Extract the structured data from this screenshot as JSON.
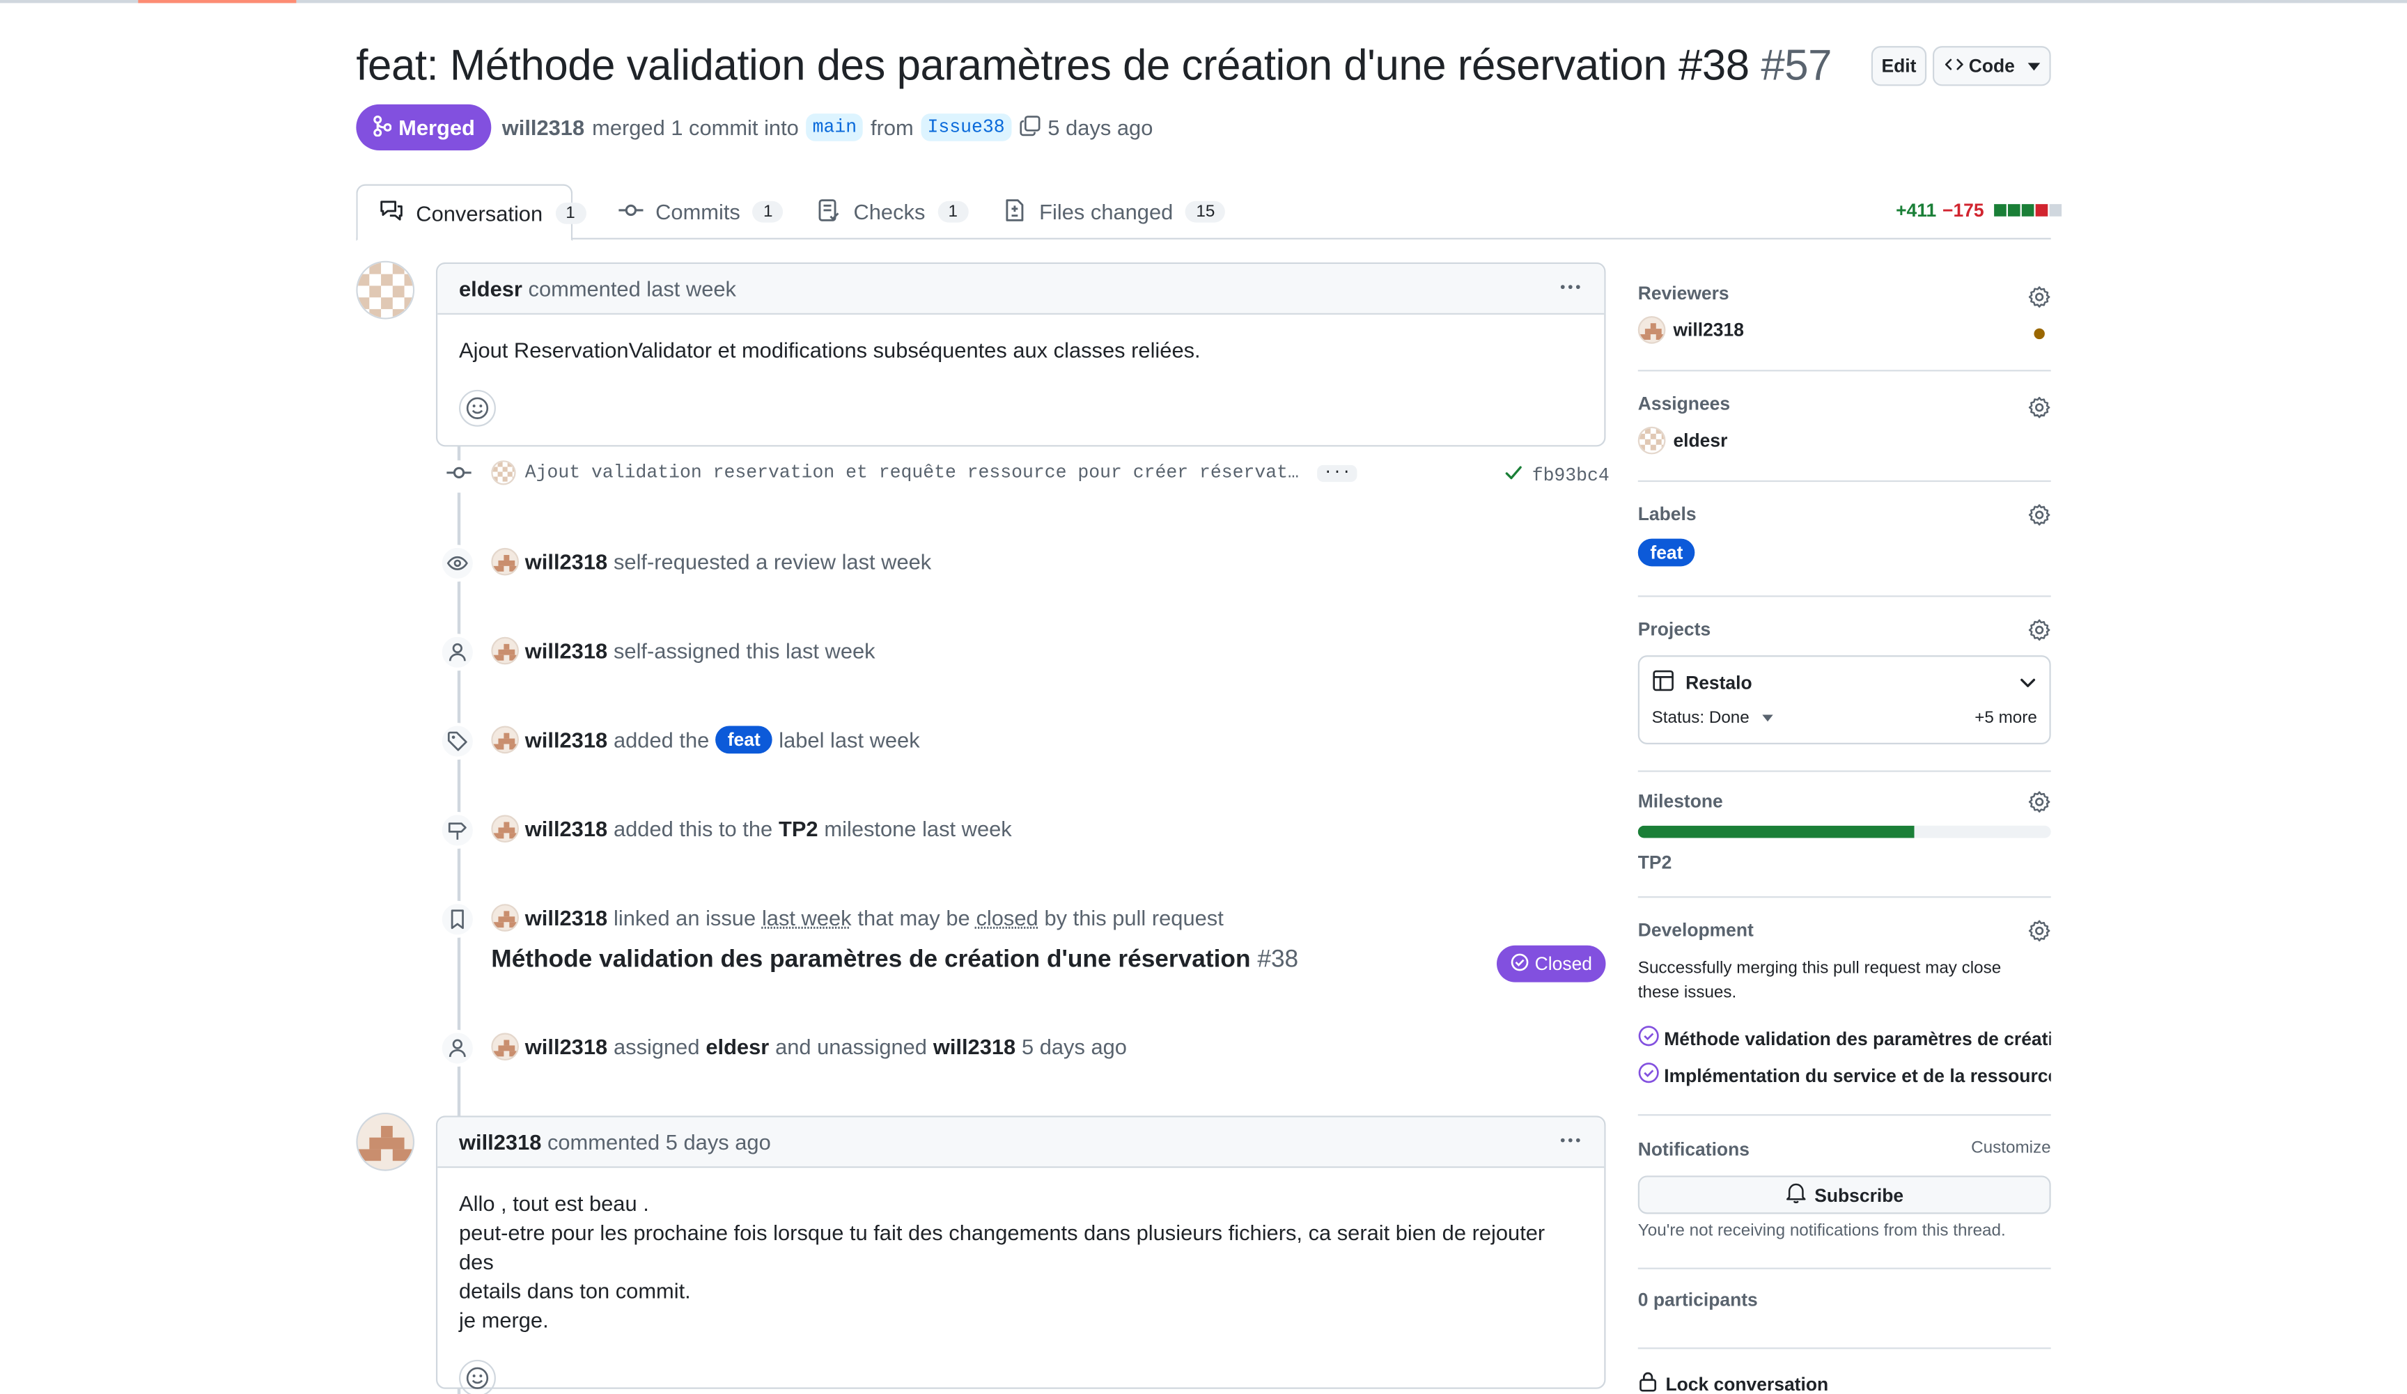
{
  "header": {
    "title": "feat: Méthode validation des paramètres de création d'une réservation #38",
    "number": "#57",
    "edit_label": "Edit",
    "code_label": "Code",
    "state_label": "Merged",
    "author": "will2318",
    "merge_text": "merged 1 commit into",
    "base_branch": "main",
    "from_text": "from",
    "head_branch": "Issue38",
    "time": "5 days ago"
  },
  "tabs": [
    {
      "label": "Conversation",
      "count": "1"
    },
    {
      "label": "Commits",
      "count": "1"
    },
    {
      "label": "Checks",
      "count": "1"
    },
    {
      "label": "Files changed",
      "count": "15"
    }
  ],
  "diffstat": {
    "additions": "+411",
    "deletions": "−175"
  },
  "timeline": {
    "comment1": {
      "author": "eldesr",
      "meta": "commented last week",
      "body": "Ajout ReservationValidator et modifications subséquentes aux classes reliées."
    },
    "commit": {
      "message": "Ajout validation reservation et requête ressource pour créer réservat…",
      "more": "···",
      "sha": "fb93bc4"
    },
    "events": [
      {
        "actor": "will2318",
        "text": "self-requested a review last week"
      },
      {
        "actor": "will2318",
        "text": "self-assigned this last week"
      },
      {
        "actor": "will2318",
        "text_before": "added the",
        "label": "feat",
        "text_after": "label last week"
      },
      {
        "actor": "will2318",
        "text_before": "added this to the",
        "milestone": "TP2",
        "text_after": "milestone last week"
      },
      {
        "actor": "will2318",
        "text_before": "linked an issue",
        "link": "last week",
        "text_after": "that may be",
        "closed_word": "closed",
        "text_end": "by this pull request"
      },
      {
        "actor": "will2318",
        "text_before": "assigned",
        "assignee": "eldesr",
        "text_mid": "and unassigned",
        "unassignee": "will2318",
        "text_after": "5 days ago"
      }
    ],
    "linked_issue": {
      "title": "Méthode validation des paramètres de création d'une réservation",
      "number": "#38",
      "state": "Closed"
    },
    "comment2": {
      "author": "will2318",
      "meta": "commented 5 days ago",
      "lines": [
        "Allo , tout est beau .",
        "peut-etre pour les prochaine fois lorsque tu fait des changements dans plusieurs fichiers, ca serait bien de rejouter des",
        "details dans ton commit.",
        "je merge."
      ]
    }
  },
  "sidebar": {
    "reviewers_title": "Reviewers",
    "reviewer": "will2318",
    "assignees_title": "Assignees",
    "assignee": "eldesr",
    "labels_title": "Labels",
    "label": "feat",
    "projects_title": "Projects",
    "project_name": "Restalo",
    "project_status": "Status: Done",
    "project_more": "+5 more",
    "milestone_title": "Milestone",
    "milestone_name": "TP2",
    "milestone_progress": 0.67,
    "development_title": "Development",
    "development_text_1": "Successfully merging this pull request may close",
    "development_text_2": "these issues.",
    "dev_issue_1": "Méthode validation des paramètres de créati...",
    "dev_issue_2": "Implémentation du service et de la ressource...",
    "notifications_title": "Notifications",
    "customize": "Customize",
    "subscribe": "Subscribe",
    "notif_text": "You're not receiving notifications from this thread.",
    "participants": "0 participants",
    "lock": "Lock conversation"
  },
  "colors": {
    "merged": "#8250df",
    "label_feat": "#0c5ad9",
    "additions": "#1a7f37",
    "deletions": "#d1242f",
    "reviewer_pending": "#9a6700"
  }
}
